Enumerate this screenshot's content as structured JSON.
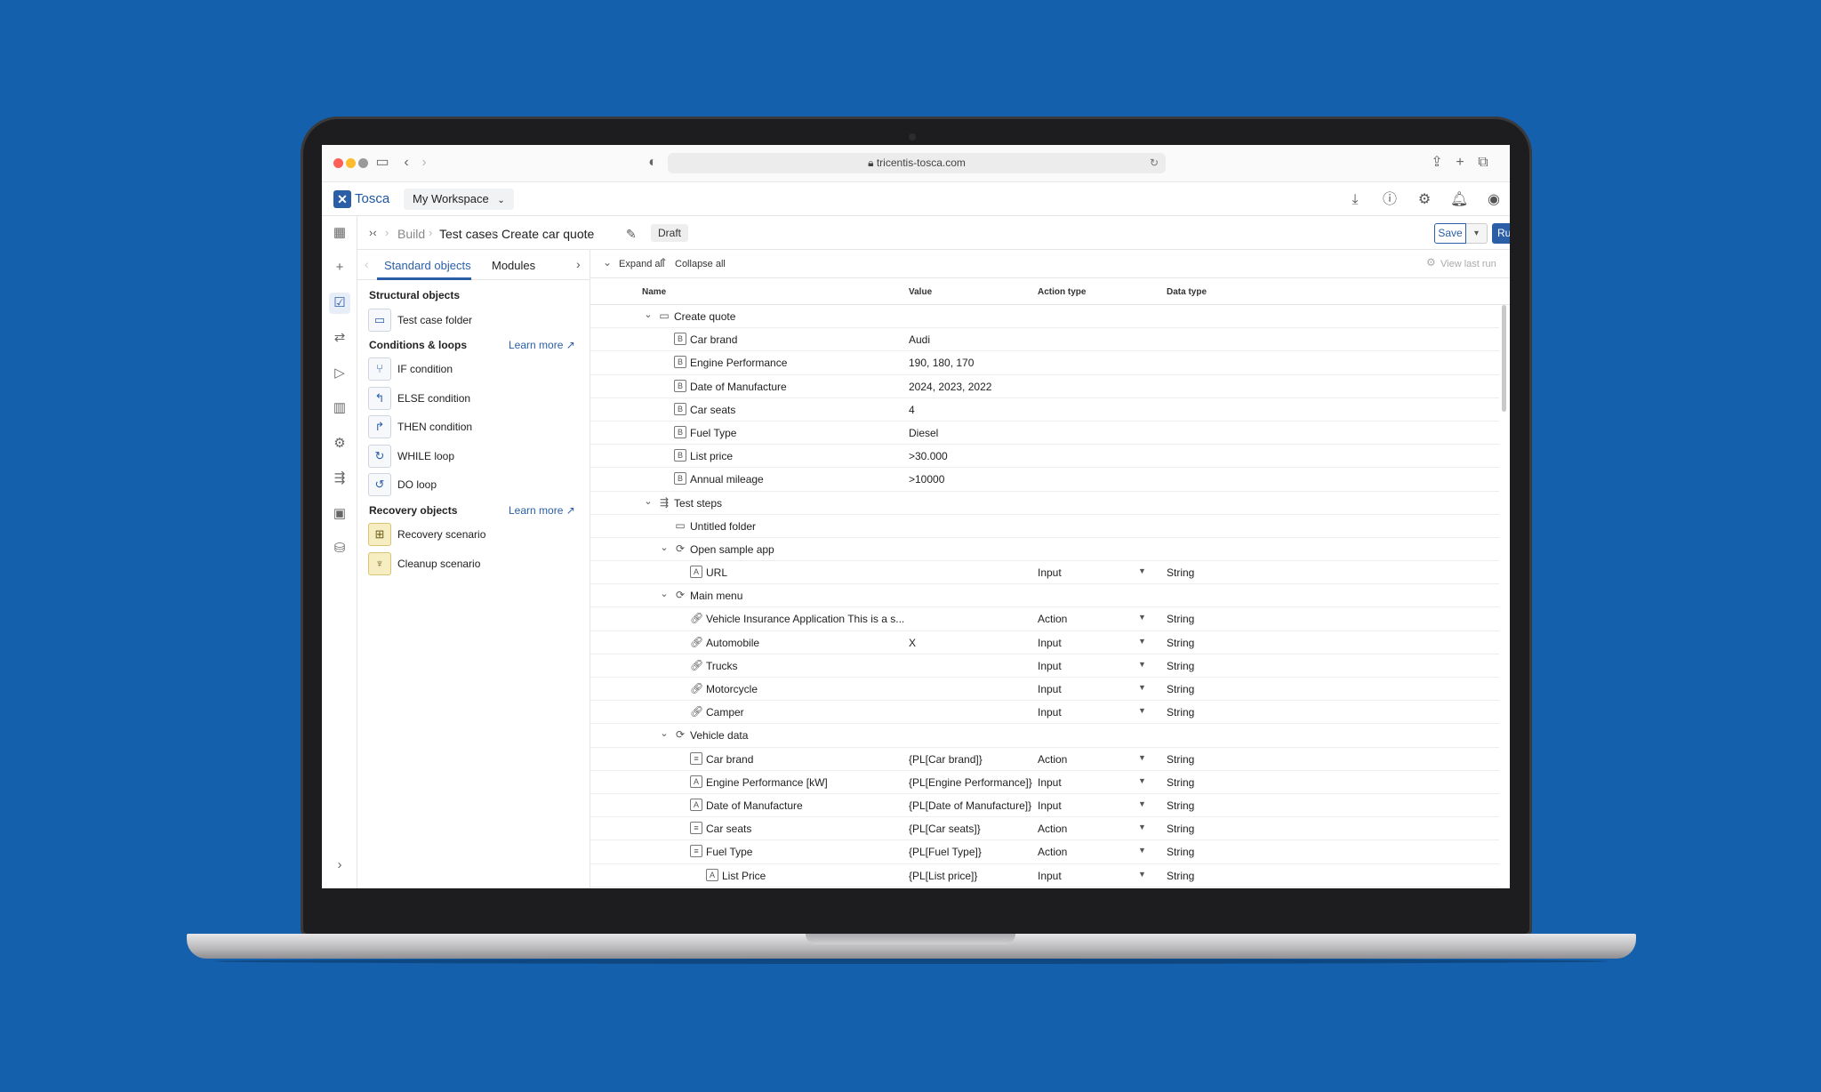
{
  "browser": {
    "url": "tricentis-tosca.com"
  },
  "app": {
    "name": "Tosca",
    "workspace": "My Workspace"
  },
  "breadcrumb": {
    "build": "Build",
    "testcases": "Test cases",
    "current": "Create car quote",
    "status": "Draft"
  },
  "actions": {
    "save": "Save",
    "run": "Run"
  },
  "panel": {
    "tabs": [
      "Standard objects",
      "Modules"
    ],
    "structural_title": "Structural objects",
    "conditions_title": "Conditions & loops",
    "recovery_title": "Recovery objects",
    "learn_more": "Learn more",
    "structural": [
      {
        "label": "Test case folder",
        "icon": "folder-icon"
      }
    ],
    "conditions": [
      {
        "label": "IF condition",
        "icon": "if-icon"
      },
      {
        "label": "ELSE condition",
        "icon": "else-icon"
      },
      {
        "label": "THEN condition",
        "icon": "then-icon"
      },
      {
        "label": "WHILE loop",
        "icon": "while-icon"
      },
      {
        "label": "DO loop",
        "icon": "do-icon"
      }
    ],
    "recovery": [
      {
        "label": "Recovery scenario",
        "icon": "recovery-icon"
      },
      {
        "label": "Cleanup scenario",
        "icon": "cleanup-icon"
      }
    ]
  },
  "toolbar": {
    "expand": "Expand all",
    "collapse": "Collapse all",
    "view_last_run": "View last run"
  },
  "table": {
    "columns": [
      "Name",
      "Value",
      "Action type",
      "Data type"
    ],
    "rows": [
      {
        "level": 0,
        "expander": true,
        "icon": "folder",
        "name": "Create quote",
        "value": "",
        "action": "",
        "type": ""
      },
      {
        "level": 1,
        "expander": false,
        "icon": "B",
        "name": "Car brand",
        "value": "Audi",
        "action": "",
        "type": ""
      },
      {
        "level": 1,
        "expander": false,
        "icon": "B",
        "name": "Engine Performance",
        "value": "190, 180, 170",
        "action": "",
        "type": ""
      },
      {
        "level": 1,
        "expander": false,
        "icon": "B",
        "name": "Date of Manufacture",
        "value": "2024, 2023, 2022",
        "action": "",
        "type": ""
      },
      {
        "level": 1,
        "expander": false,
        "icon": "B",
        "name": "Car seats",
        "value": "4",
        "action": "",
        "type": ""
      },
      {
        "level": 1,
        "expander": false,
        "icon": "B",
        "name": "Fuel Type",
        "value": "Diesel",
        "action": "",
        "type": ""
      },
      {
        "level": 1,
        "expander": false,
        "icon": "B",
        "name": "List price",
        "value": ">30.000",
        "action": "",
        "type": ""
      },
      {
        "level": 1,
        "expander": false,
        "icon": "B",
        "name": "Annual mileage",
        "value": ">10000",
        "action": "",
        "type": ""
      },
      {
        "level": 0,
        "expander": true,
        "icon": "steps",
        "name": "Test steps",
        "value": "",
        "action": "",
        "type": ""
      },
      {
        "level": 1,
        "expander": false,
        "icon": "folder",
        "name": "Untitled folder",
        "value": "",
        "action": "",
        "type": ""
      },
      {
        "level": 1,
        "expander": true,
        "icon": "module",
        "name": "Open sample app",
        "value": "",
        "action": "",
        "type": ""
      },
      {
        "level": 2,
        "expander": false,
        "icon": "A",
        "name": "URL",
        "value": "",
        "action": "Input",
        "type": "String"
      },
      {
        "level": 1,
        "expander": true,
        "icon": "module",
        "name": "Main menu",
        "value": "",
        "action": "",
        "type": ""
      },
      {
        "level": 2,
        "expander": false,
        "icon": "link",
        "name": "Vehicle Insurance Application This is a s...",
        "value": "",
        "action": "Action",
        "type": "String"
      },
      {
        "level": 2,
        "expander": false,
        "icon": "link",
        "name": "Automobile",
        "value": "X",
        "action": "Input",
        "type": "String"
      },
      {
        "level": 2,
        "expander": false,
        "icon": "link",
        "name": "Trucks",
        "value": "",
        "action": "Input",
        "type": "String"
      },
      {
        "level": 2,
        "expander": false,
        "icon": "link",
        "name": "Motorcycle",
        "value": "",
        "action": "Input",
        "type": "String"
      },
      {
        "level": 2,
        "expander": false,
        "icon": "link",
        "name": "Camper",
        "value": "",
        "action": "Input",
        "type": "String"
      },
      {
        "level": 1,
        "expander": true,
        "icon": "module",
        "name": "Vehicle data",
        "value": "",
        "action": "",
        "type": ""
      },
      {
        "level": 2,
        "expander": false,
        "icon": "list",
        "name": "Car brand",
        "value": "{PL[Car brand]}",
        "action": "Action",
        "type": "String"
      },
      {
        "level": 2,
        "expander": false,
        "icon": "A",
        "name": "Engine Performance [kW]",
        "value": "{PL[Engine Performance]}",
        "action": "Input",
        "type": "String"
      },
      {
        "level": 2,
        "expander": false,
        "icon": "A",
        "name": "Date of Manufacture",
        "value": "{PL[Date of Manufacture]}",
        "action": "Input",
        "type": "String"
      },
      {
        "level": 2,
        "expander": false,
        "icon": "list",
        "name": "Car seats",
        "value": "{PL[Car seats]}",
        "action": "Action",
        "type": "String"
      },
      {
        "level": 2,
        "expander": false,
        "icon": "list",
        "name": "Fuel Type",
        "value": "{PL[Fuel Type]}",
        "action": "Action",
        "type": "String"
      },
      {
        "level": 3,
        "expander": false,
        "icon": "A",
        "name": "List Price",
        "value": "{PL[List price]}",
        "action": "Input",
        "type": "String"
      }
    ]
  },
  "colors": {
    "background": "#1560ad",
    "brand": "#2a5fa8"
  }
}
